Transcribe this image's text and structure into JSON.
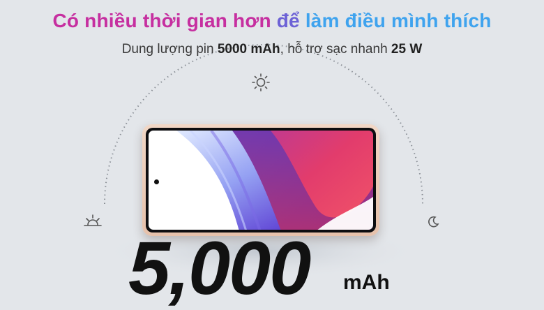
{
  "headline": {
    "part1": "Có nhiều thời gian hơn ",
    "part2": "để ",
    "part3": "làm điều mình thích",
    "colors": [
      "#c62fa0",
      "#6d62d6",
      "#3fa3ee"
    ]
  },
  "subline": {
    "prefix": "Dung lượng pin ",
    "capacity": "5000 mAh",
    "middle": ", hỗ trợ sạc nhanh ",
    "charging": "25 W"
  },
  "icons": {
    "left": "sunrise-icon",
    "top": "sun-icon",
    "right": "moon-icon"
  },
  "battery": {
    "number": "5,000",
    "unit": "mAh"
  },
  "phone": {
    "frame_color": "#ecc9b4"
  }
}
